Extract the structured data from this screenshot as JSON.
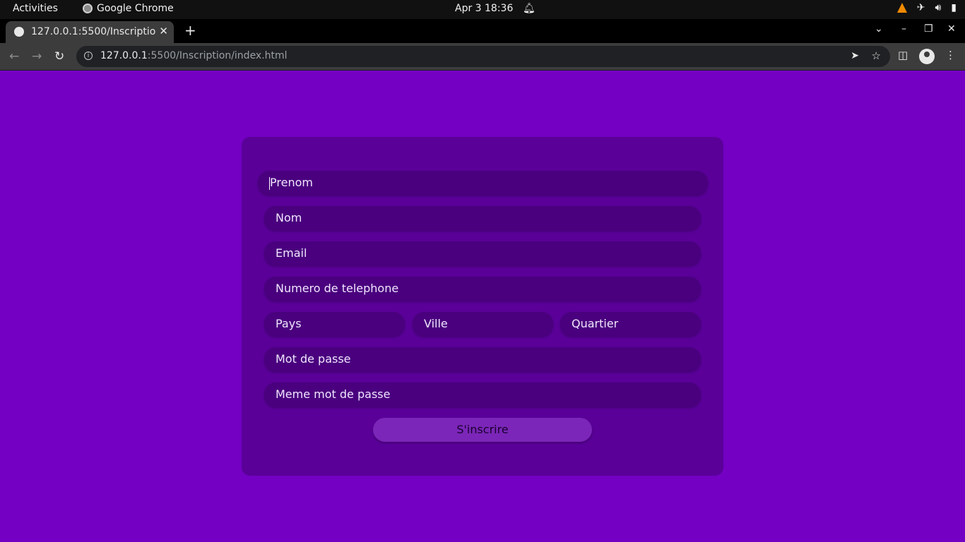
{
  "system_bar": {
    "activities": "Activities",
    "app_name": "Google Chrome",
    "datetime": "Apr 3  18:36"
  },
  "browser": {
    "tab_title": "127.0.0.1:5500/Inscription/index.html",
    "url_host": "127.0.0.1",
    "url_rest": ":5500/Inscription/index.html"
  },
  "form": {
    "fields": {
      "prenom": "Prenom",
      "nom": "Nom",
      "email": "Email",
      "telephone": "Numero de telephone",
      "pays": "Pays",
      "ville": "Ville",
      "quartier": "Quartier",
      "mot_de_passe": "Mot de passe",
      "meme_mot_de_passe": "Meme mot de passe"
    },
    "submit_label": "S'inscrire"
  },
  "colors": {
    "page_background": "#7300c2",
    "card_background": "#5a0099",
    "field_background": "#4a007e",
    "button_background": "#7b26b8"
  }
}
